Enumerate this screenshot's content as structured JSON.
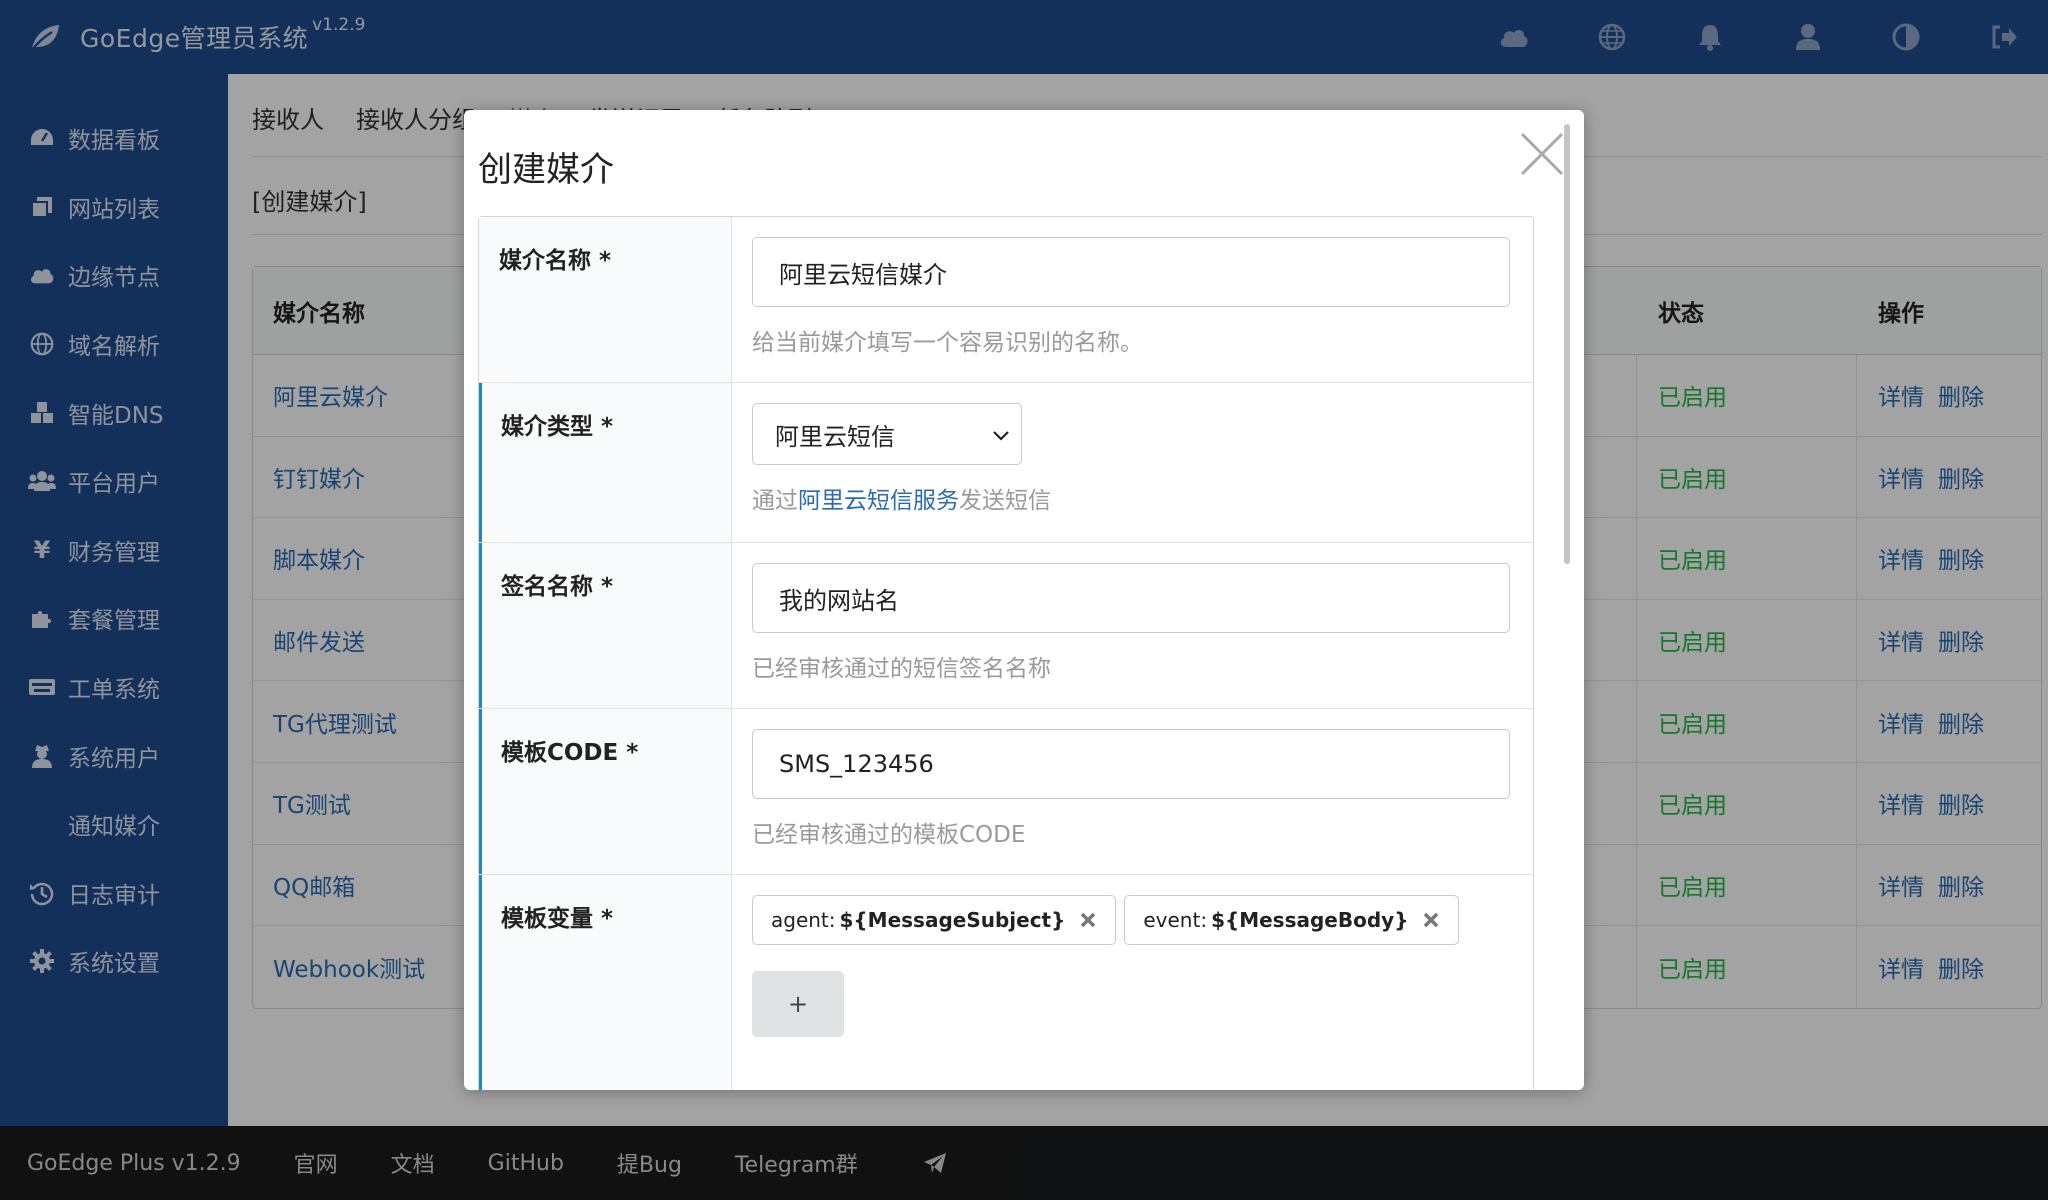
{
  "header": {
    "title": "GoEdge管理员系统",
    "version": "v1.2.9",
    "icons": [
      "cloud-icon",
      "globe-icon",
      "bell-icon",
      "user-icon",
      "contrast-icon",
      "logout-icon"
    ]
  },
  "sidebar": {
    "items": [
      {
        "label": "数据看板",
        "icon": "dashboard-icon"
      },
      {
        "label": "网站列表",
        "icon": "copy-icon"
      },
      {
        "label": "边缘节点",
        "icon": "cloud-icon"
      },
      {
        "label": "域名解析",
        "icon": "globe-icon"
      },
      {
        "label": "智能DNS",
        "icon": "cubes-icon"
      },
      {
        "label": "平台用户",
        "icon": "users-icon"
      },
      {
        "label": "财务管理",
        "icon": "yen-icon"
      },
      {
        "label": "套餐管理",
        "icon": "puzzle-icon"
      },
      {
        "label": "工单系统",
        "icon": "keyboard-icon"
      },
      {
        "label": "系统用户",
        "icon": "user-secret-icon"
      },
      {
        "label": "通知媒介",
        "icon": ""
      },
      {
        "label": "日志审计",
        "icon": "history-icon"
      },
      {
        "label": "系统设置",
        "icon": "gear-icon"
      }
    ]
  },
  "main": {
    "tabs": [
      "接收人",
      "接收人分组",
      "媒介",
      "发送记录",
      "任务队列"
    ],
    "breadcrumb": "[创建媒介]",
    "table": {
      "headers": {
        "name": "媒介名称",
        "status": "状态",
        "op": "操作"
      },
      "rows": [
        {
          "name": "阿里云媒介",
          "status": "已启用"
        },
        {
          "name": "钉钉媒介",
          "status": "已启用"
        },
        {
          "name": "脚本媒介",
          "status": "已启用"
        },
        {
          "name": "邮件发送",
          "status": "已启用"
        },
        {
          "name": "TG代理测试",
          "status": "已启用"
        },
        {
          "name": "TG测试",
          "status": "已启用"
        },
        {
          "name": "QQ邮箱",
          "status": "已启用"
        },
        {
          "name": "Webhook测试",
          "status": "已启用"
        }
      ],
      "op_detail": "详情",
      "op_delete": "删除"
    }
  },
  "modal": {
    "title": "创建媒介",
    "fields": {
      "name": {
        "label": "媒介名称 *",
        "value": "阿里云短信媒介",
        "hint": "给当前媒介填写一个容易识别的名称。"
      },
      "type": {
        "label": "媒介类型 *",
        "value": "阿里云短信",
        "hint_prefix": "通过",
        "hint_link": "阿里云短信服务",
        "hint_suffix": "发送短信"
      },
      "sign": {
        "label": "签名名称 *",
        "value": "我的网站名",
        "hint": "已经审核通过的短信签名名称"
      },
      "template": {
        "label": "模板CODE *",
        "value": "SMS_123456",
        "hint": "已经审核通过的模板CODE"
      },
      "vars": {
        "label": "模板变量 *",
        "tags": [
          {
            "key": "agent:",
            "value": "${MessageSubject}"
          },
          {
            "key": "event:",
            "value": "${MessageBody}"
          }
        ],
        "add_label": "+"
      }
    }
  },
  "footer": {
    "items": [
      "GoEdge Plus v1.2.9",
      "官网",
      "文档",
      "GitHub",
      "提Bug",
      "Telegram群"
    ]
  },
  "colors": {
    "brand": "#1f4b8f",
    "link": "#2a6bb3",
    "active": "#21ba45",
    "footer": "#1b1c1d"
  }
}
